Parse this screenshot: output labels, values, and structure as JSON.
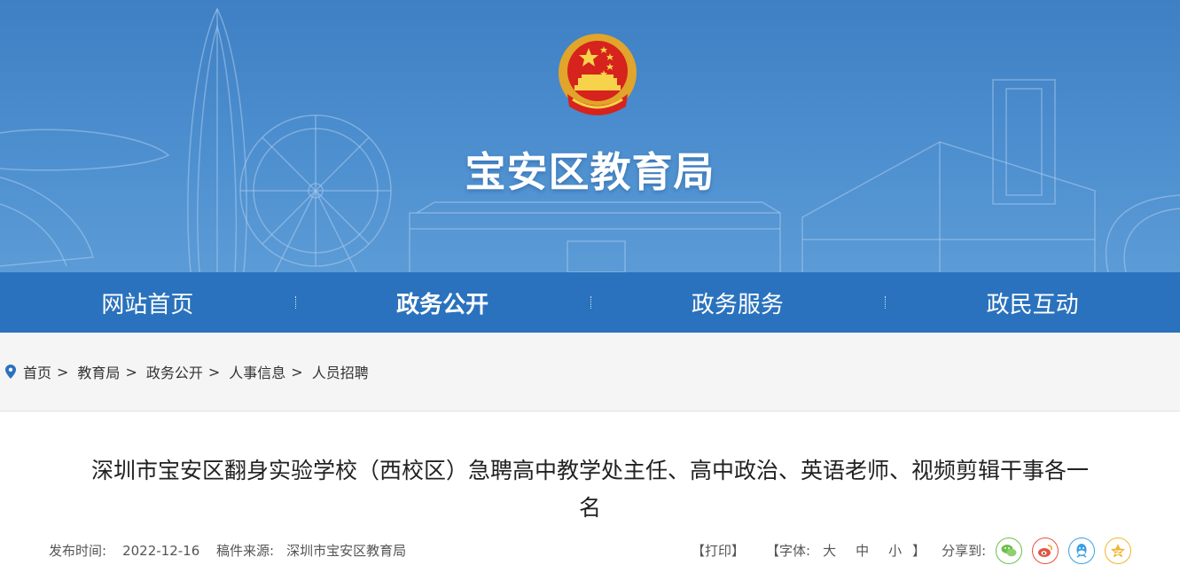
{
  "site": {
    "title": "宝安区教育局"
  },
  "nav": [
    {
      "label": "网站首页",
      "active": false
    },
    {
      "label": "政务公开",
      "active": true
    },
    {
      "label": "政务服务",
      "active": false
    },
    {
      "label": "政民互动",
      "active": false
    }
  ],
  "breadcrumb": {
    "separator": ">",
    "items": [
      "首页",
      "教育局",
      "政务公开",
      "人事信息",
      "人员招聘"
    ]
  },
  "article": {
    "title_line1": "深圳市宝安区翻身实验学校（西校区）急聘高中教学处主任、高中政治、英语老师、视频剪辑干事各一",
    "title_line2": "名",
    "publish_label": "发布时间:",
    "publish_date": "2022-12-16",
    "source_label": "稿件来源:",
    "source": "深圳市宝安区教育局"
  },
  "tools": {
    "print": "【打印】",
    "font_open": "【字体:",
    "font_large": "大",
    "font_medium": "中",
    "font_small": "小",
    "font_close": "】",
    "share_label": "分享到:"
  },
  "share_icons": [
    {
      "name": "wechat-icon",
      "color": "#6dbf4b"
    },
    {
      "name": "weibo-icon",
      "color": "#e6533f"
    },
    {
      "name": "qq-icon",
      "color": "#3aa0e6"
    },
    {
      "name": "qzone-icon",
      "color": "#f2b42b"
    }
  ],
  "colors": {
    "nav_bg": "#2a72bd",
    "banner_bg": "#4a8ccd",
    "breadcrumb_bg": "#f5f5f5"
  }
}
